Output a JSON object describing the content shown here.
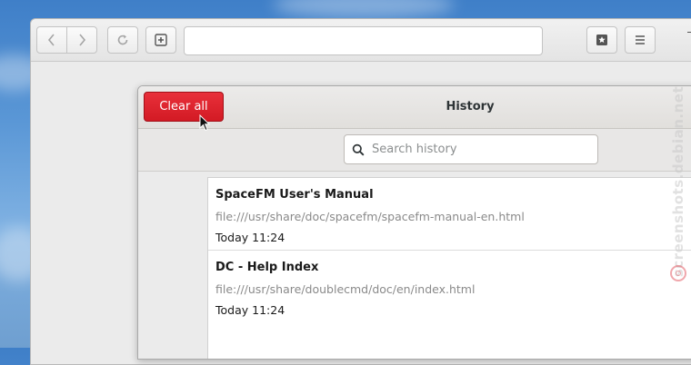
{
  "browser": {
    "url_value": ""
  },
  "history_dialog": {
    "title": "History",
    "clear_button_label": "Clear all",
    "search_placeholder": "Search history",
    "entries": [
      {
        "title": "SpaceFM User's Manual",
        "url": "file:///usr/share/doc/spacefm/spacefm-manual-en.html",
        "time": "Today 11:24"
      },
      {
        "title": "DC - Help Index",
        "url": "file:///usr/share/doublecmd/doc/en/index.html",
        "time": "Today 11:24"
      }
    ]
  },
  "watermark": {
    "text": "screenshots.debian.net"
  },
  "colors": {
    "destructive_button": "#d31a24",
    "accent_text": "#1a1a1a"
  }
}
